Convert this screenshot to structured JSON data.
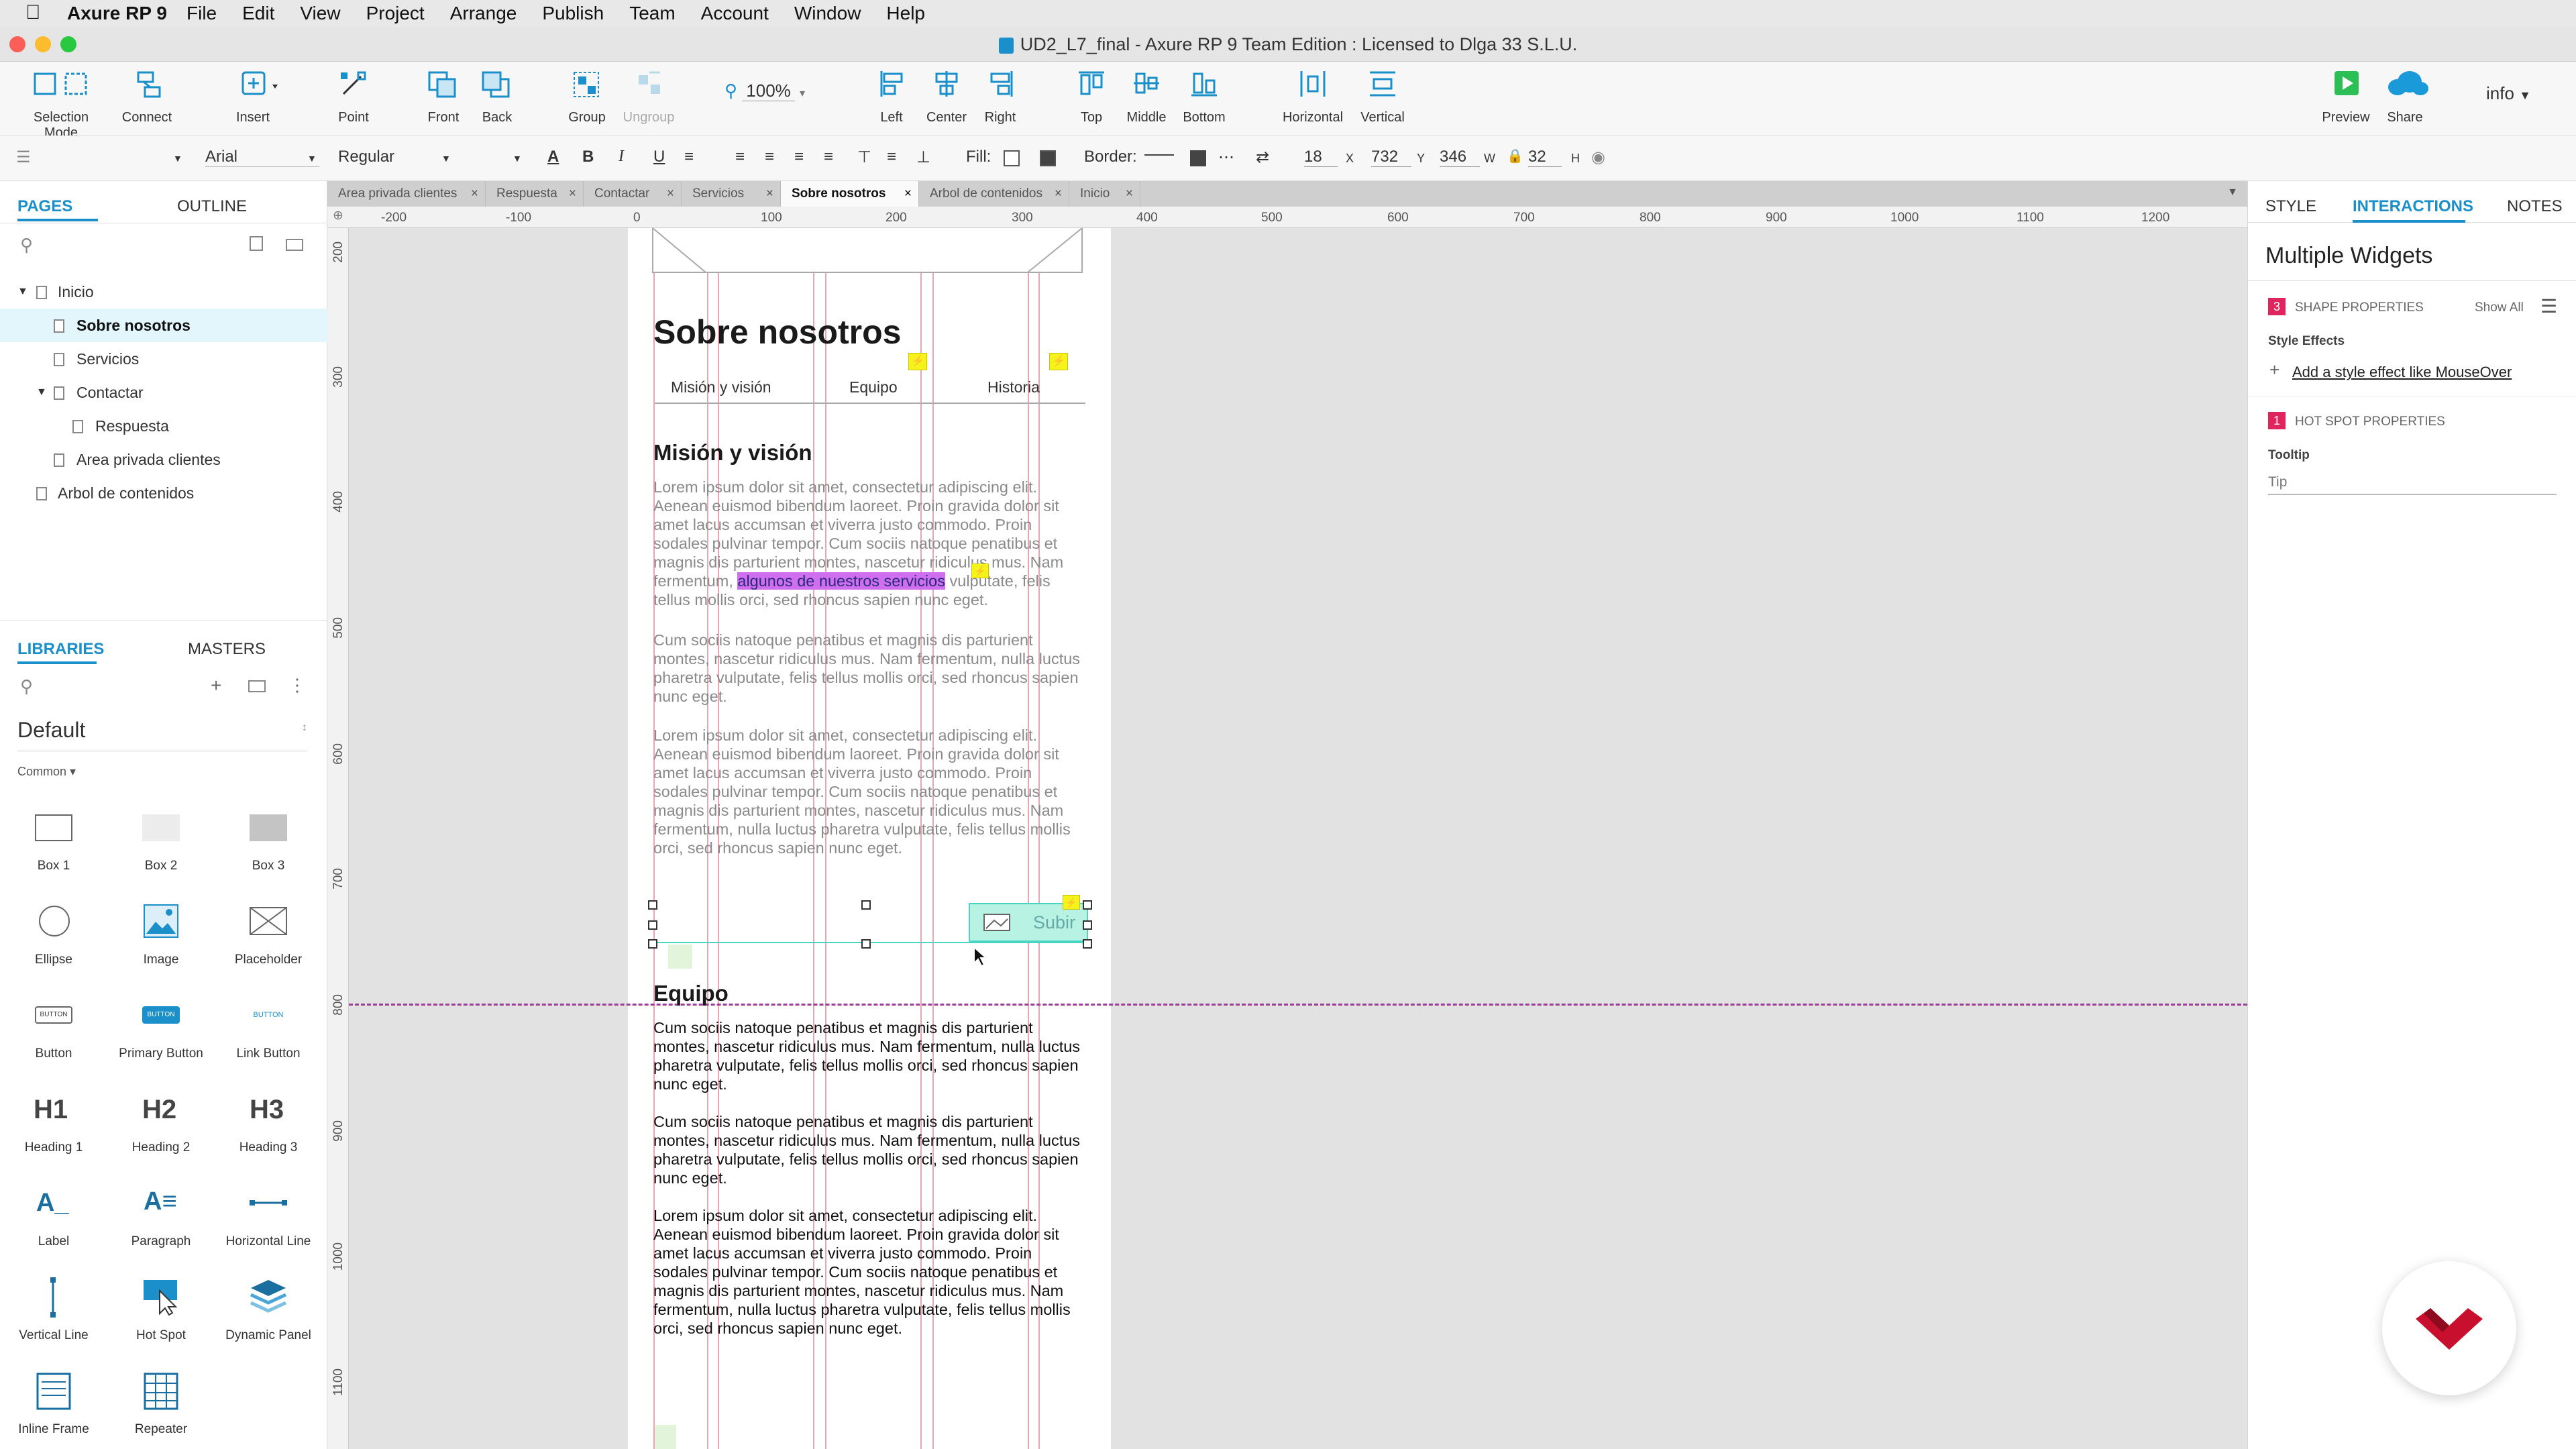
{
  "menubar": {
    "app": "Axure RP 9",
    "items": [
      "File",
      "Edit",
      "View",
      "Project",
      "Arrange",
      "Publish",
      "Team",
      "Account",
      "Window",
      "Help"
    ]
  },
  "window": {
    "title": "UD2_L7_final - Axure RP 9 Team Edition : Licensed to Dlga 33 S.L.U."
  },
  "toolbar": {
    "selection_mode": "Selection Mode",
    "connect": "Connect",
    "insert": "Insert",
    "point": "Point",
    "front": "Front",
    "back": "Back",
    "group": "Group",
    "ungroup": "Ungroup",
    "zoom": "100%",
    "left": "Left",
    "center": "Center",
    "right": "Right",
    "top": "Top",
    "middle": "Middle",
    "bottom": "Bottom",
    "horizontal": "Horizontal",
    "vertical": "Vertical",
    "preview": "Preview",
    "share": "Share",
    "user": "info"
  },
  "format": {
    "font": "Arial",
    "weight": "Regular",
    "fill_label": "Fill:",
    "border_label": "Border:",
    "border_size": "18",
    "x_label": "X",
    "x": "732",
    "y_label": "Y",
    "y": "346",
    "w_label": "W",
    "w": "32",
    "h_label": "H"
  },
  "left_panel": {
    "tabs": [
      "PAGES",
      "OUTLINE"
    ],
    "pages": [
      {
        "label": "Inicio",
        "level": 0
      },
      {
        "label": "Sobre nosotros",
        "level": 1,
        "selected": true
      },
      {
        "label": "Servicios",
        "level": 1
      },
      {
        "label": "Contactar",
        "level": 1
      },
      {
        "label": "Respuesta",
        "level": 2
      },
      {
        "label": "Area privada clientes",
        "level": 1
      },
      {
        "label": "Arbol de contenidos",
        "level": 0
      }
    ],
    "lib_tabs": [
      "LIBRARIES",
      "MASTERS"
    ],
    "library": "Default",
    "category": "Common ▾",
    "widgets": [
      "Box 1",
      "Box 2",
      "Box 3",
      "Ellipse",
      "Image",
      "Placeholder",
      "Button",
      "Primary Button",
      "Link Button",
      "Heading 1",
      "Heading 2",
      "Heading 3",
      "Label",
      "Paragraph",
      "Horizontal Line",
      "Vertical Line",
      "Hot Spot",
      "Dynamic Panel",
      "Inline Frame",
      "Repeater"
    ]
  },
  "doc_tabs": [
    "Area privada clientes",
    "Respuesta",
    "Contactar",
    "Servicios",
    "Sobre nosotros",
    "Arbol de contenidos",
    "Inicio"
  ],
  "ruler": {
    "h": [
      "-200",
      "-100",
      "0",
      "100",
      "200",
      "300",
      "400",
      "500",
      "600",
      "700",
      "800",
      "900",
      "1000",
      "1100",
      "1200"
    ],
    "v": [
      "200",
      "300",
      "400",
      "500",
      "600",
      "700",
      "800",
      "900",
      "1000",
      "1100"
    ]
  },
  "page": {
    "title": "Sobre nosotros",
    "nav": [
      "Misión y visión",
      "Equipo",
      "Historia"
    ],
    "h_mision": "Misión y visión",
    "p1_a": "Lorem ipsum dolor sit amet, consectetur adipiscing elit. Aenean euismod bibendum laoreet. Proin gravida dolor sit amet lacus accumsan et viverra justo commodo. Proin sodales pulvinar tempor. Cum sociis natoque penatibus et magnis dis parturient montes, nascetur ridiculus mus. Nam fermentum, ",
    "p1_link": "algunos de nuestros servicios",
    "p1_b": " vulputate, felis tellus mollis orci, sed rhoncus sapien nunc eget.",
    "p2": "Cum sociis natoque penatibus et magnis dis parturient montes, nascetur ridiculus mus. Nam fermentum, nulla luctus pharetra vulputate, felis tellus mollis orci, sed rhoncus sapien nunc eget.",
    "p3": "Lorem ipsum dolor sit amet, consectetur adipiscing elit. Aenean euismod bibendum laoreet. Proin gravida dolor sit amet lacus accumsan et viverra justo commodo. Proin sodales pulvinar tempor. Cum sociis natoque penatibus et magnis dis parturient montes, nascetur ridiculus mus. Nam fermentum, nulla luctus pharetra vulputate, felis tellus mollis orci, sed rhoncus sapien nunc eget.",
    "subir": "Subir",
    "h_equipo": "Equipo",
    "e1": "Cum sociis natoque penatibus et magnis dis parturient montes, nascetur ridiculus mus. Nam fermentum, nulla luctus pharetra vulputate, felis tellus mollis orci, sed rhoncus sapien nunc eget.",
    "e2": "Cum sociis natoque penatibus et magnis dis parturient montes, nascetur ridiculus mus. Nam fermentum, nulla luctus pharetra vulputate, felis tellus mollis orci, sed rhoncus sapien nunc eget.",
    "e3": "Lorem ipsum dolor sit amet, consectetur adipiscing elit. Aenean euismod bibendum laoreet. Proin gravida dolor sit amet lacus accumsan et viverra justo commodo. Proin sodales pulvinar tempor. Cum sociis natoque penatibus et magnis dis parturient montes, nascetur ridiculus mus. Nam fermentum, nulla luctus pharetra vulputate, felis tellus mollis orci, sed rhoncus sapien nunc eget."
  },
  "right_panel": {
    "tabs": [
      "STYLE",
      "INTERACTIONS",
      "NOTES"
    ],
    "heading": "Multiple Widgets",
    "shape_count": "3",
    "shape_title": "SHAPE PROPERTIES",
    "show_all": "Show All",
    "style_effects": "Style Effects",
    "add_effect": "Add a style effect like MouseOver",
    "hotspot_count": "1",
    "hotspot_title": "HOT SPOT PROPERTIES",
    "tooltip_label": "Tooltip",
    "tooltip_placeholder": "Tip"
  },
  "colors": {
    "accent": "#1a8fc9",
    "selection": "#47d6c4",
    "guide": "#9b3c95",
    "badge": "#e0245e",
    "lightning": "#f6f21c"
  }
}
